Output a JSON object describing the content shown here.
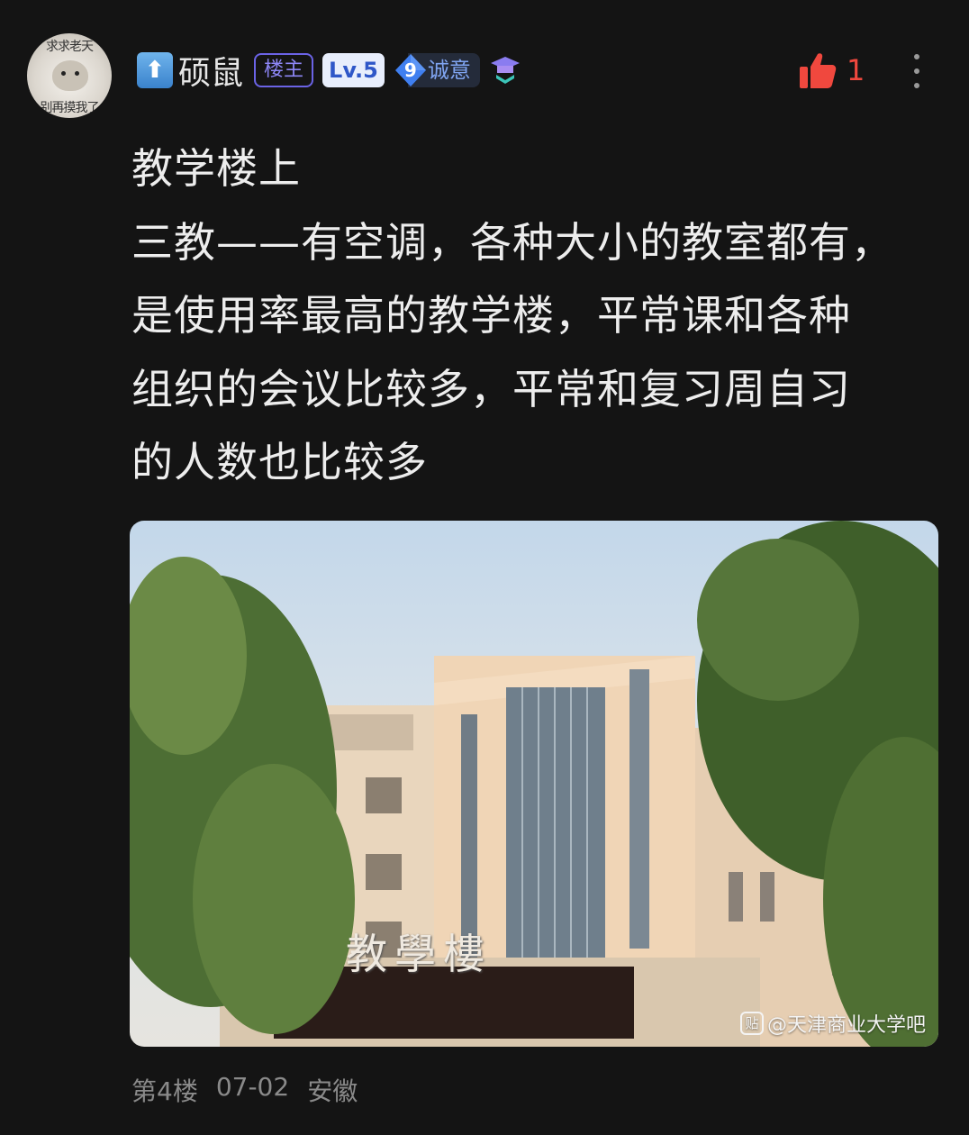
{
  "post": {
    "avatar": {
      "caption_top": "求求老天",
      "caption_bottom": "别再摸我了"
    },
    "user": {
      "name": "硕鼠",
      "host_badge": "楼主",
      "level": "Lv.5",
      "sincerity_level": "9",
      "sincerity_label": "诚意"
    },
    "like": {
      "count": "1"
    },
    "content_lines": [
      "教学楼上",
      "三教——有空调，各种大小的教室都有，",
      "是使用率最高的教学楼，平常课和各种",
      "组织的会议比较多，平常和复习周自习",
      "的人数也比较多"
    ],
    "image": {
      "sign_text": "教學樓",
      "watermark": "@天津商业大学吧",
      "watermark_icon": "贴"
    },
    "footer": {
      "floor": "第4楼",
      "date": "07-02",
      "location": "安徽"
    }
  },
  "colors": {
    "background": "#141414",
    "like": "#f0483e",
    "host_badge": "#6b63e6",
    "level_badge": "#e8eefc",
    "text_secondary": "#8a8a8a"
  },
  "icons": [
    "up-arrow-icon",
    "diamond-icon",
    "graduation-cap-icon",
    "thumbs-up-icon",
    "more-vertical-icon"
  ]
}
